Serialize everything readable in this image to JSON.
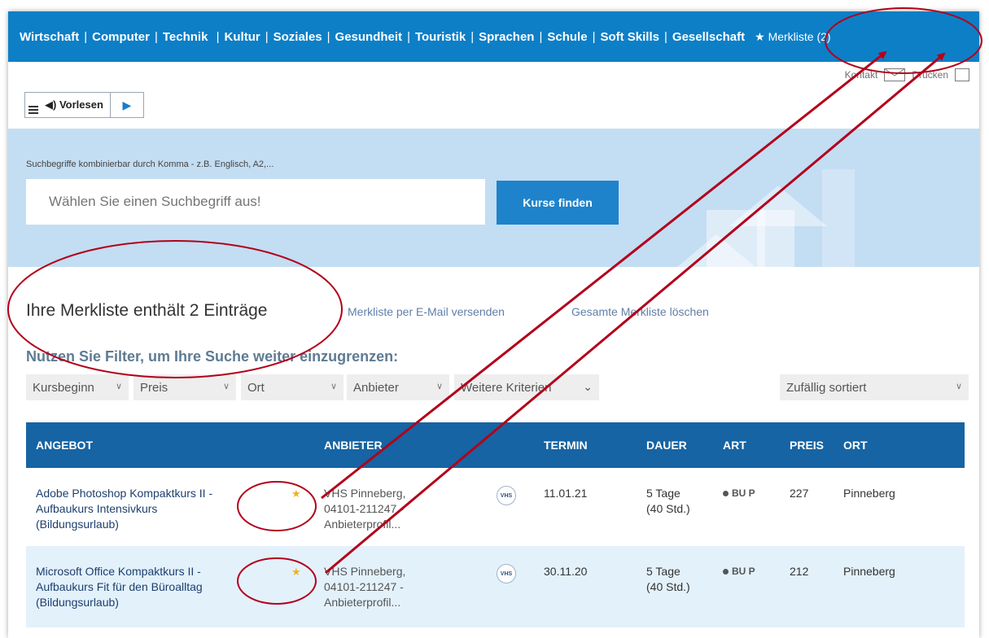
{
  "nav": {
    "categories": [
      "Wirtschaft",
      "Computer",
      "Technik",
      "Kultur",
      "Soziales",
      "Gesundheit",
      "Touristik",
      "Sprachen",
      "Schule",
      "Soft Skills",
      "Gesellschaft"
    ],
    "merkliste": "★ Merkliste (2)"
  },
  "util": {
    "contact": "Kontakt",
    "print": "Drucken"
  },
  "vorlesen": {
    "label": "◀) Vorlesen",
    "play": "▶"
  },
  "search": {
    "hint": "Suchbegriffe kombinierbar durch Komma - z.B. Englisch, A2,...",
    "placeholder": "Wählen Sie einen Suchbegriff aus!",
    "button": "Kurse finden"
  },
  "merkliste": {
    "heading": "Ihre Merkliste enthält 2 Einträge",
    "email_link": "Merkliste per E-Mail versenden",
    "delete_link": "Gesamte Merkliste löschen"
  },
  "filters": {
    "heading": "Nutzen Sie Filter, um Ihre Suche weiter einzugrenzen:",
    "kursbeginn": "Kursbeginn",
    "preis": "Preis",
    "ort": "Ort",
    "anbieter": "Anbieter",
    "weitere": "Weitere Kriterien",
    "sort": "Zufällig sortiert"
  },
  "table": {
    "headers": {
      "angebot": "ANGEBOT",
      "anbieter": "ANBIETER",
      "termin": "TERMIN",
      "dauer": "DAUER",
      "art": "ART",
      "preis": "PREIS",
      "ort": "ORT"
    },
    "rows": [
      {
        "title_1": "Adobe Photoshop Kompaktkurs II -",
        "title_2": "Aufbaukurs Intensivkurs",
        "title_3": "(Bildungsurlaub)",
        "star": "★",
        "prov_1": "VHS Pinneberg,",
        "prov_2": "04101-211247 -",
        "prov_3": "Anbieterprofil...",
        "logo": "VHS",
        "termin": "11.01.21",
        "dauer_1": "5 Tage",
        "dauer_2": "(40 Std.)",
        "art": "BU P",
        "preis": "227",
        "ort": "Pinneberg"
      },
      {
        "title_1": "Microsoft Office Kompaktkurs II -",
        "title_2": "Aufbaukurs Fit für den Büroalltag",
        "title_3": "(Bildungsurlaub)",
        "star": "★",
        "prov_1": "VHS Pinneberg,",
        "prov_2": "04101-211247 -",
        "prov_3": "Anbieterprofil...",
        "logo": "VHS",
        "termin": "30.11.20",
        "dauer_1": "5 Tage",
        "dauer_2": "(40 Std.)",
        "art": "BU P",
        "preis": "212",
        "ort": "Pinneberg"
      }
    ]
  },
  "colors": {
    "nav": "#0d7fc7",
    "table_header": "#1664a3",
    "annotation": "#b3001a",
    "row_alt": "#e3f1fb"
  }
}
